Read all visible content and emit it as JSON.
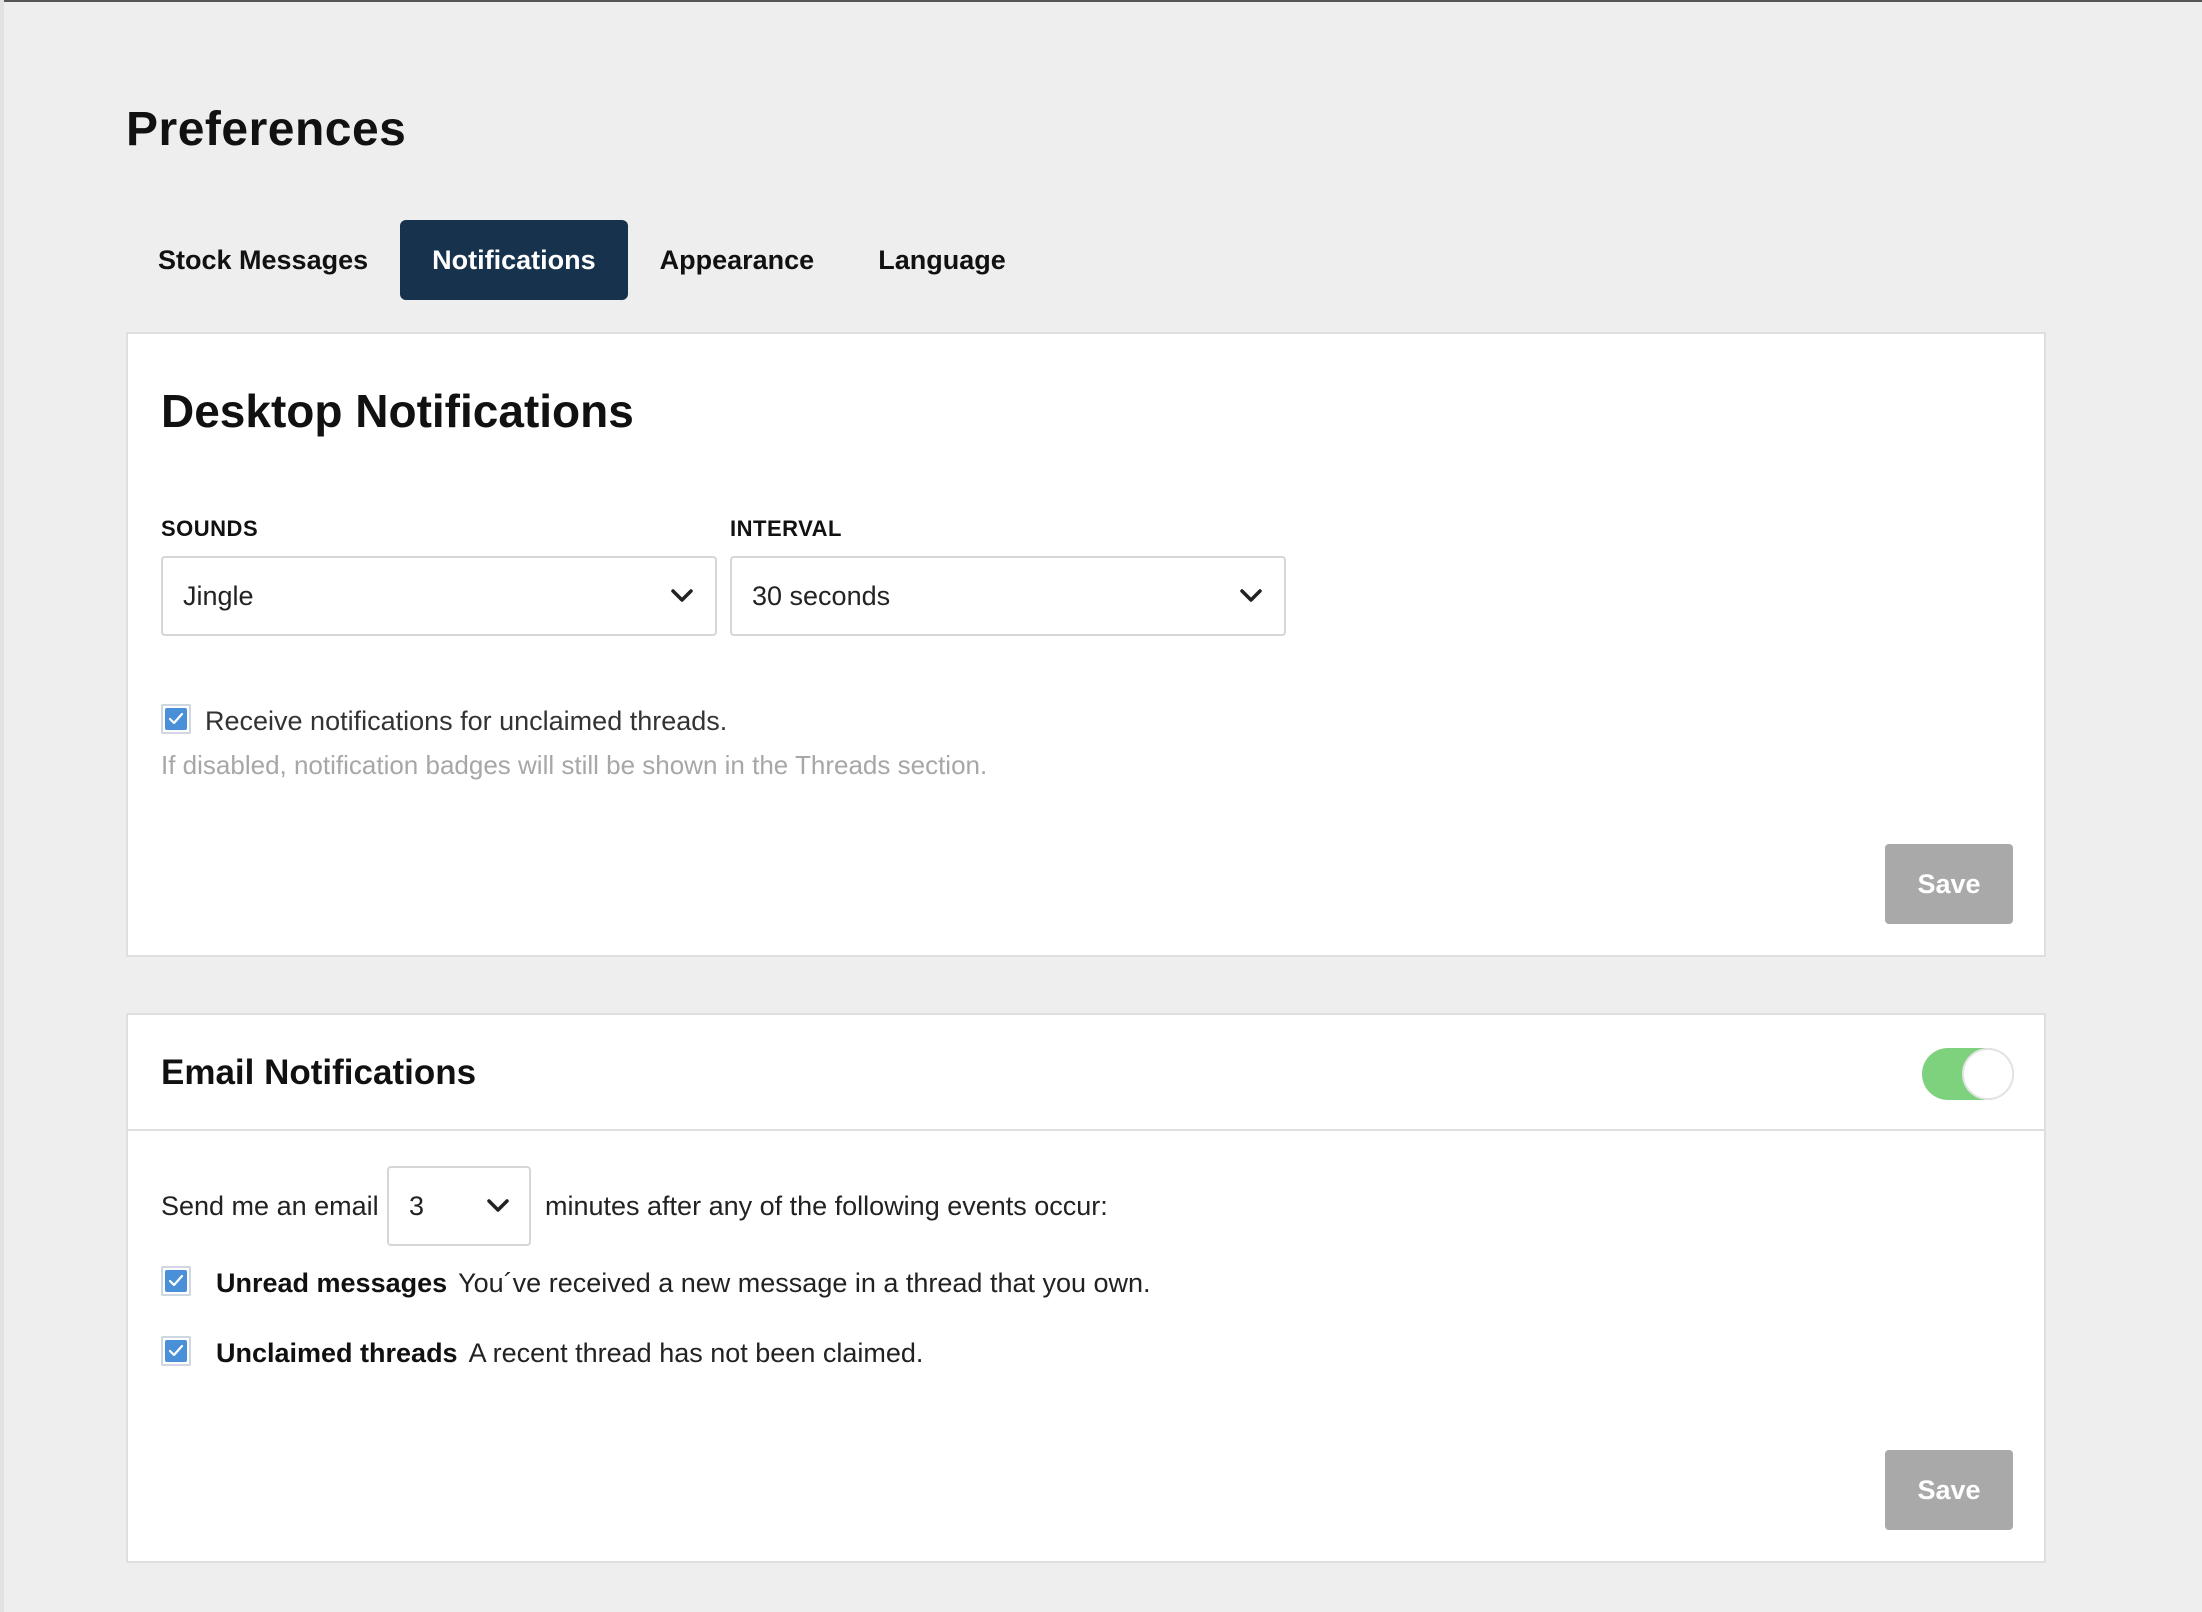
{
  "page_title": "Preferences",
  "tabs": [
    {
      "label": "Stock Messages",
      "active": false
    },
    {
      "label": "Notifications",
      "active": true
    },
    {
      "label": "Appearance",
      "active": false
    },
    {
      "label": "Language",
      "active": false
    }
  ],
  "desktop": {
    "title": "Desktop Notifications",
    "sounds_label": "SOUNDS",
    "sounds_value": "Jingle",
    "interval_label": "INTERVAL",
    "interval_value": "30 seconds",
    "unclaimed_checkbox_label": "Receive notifications for unclaimed threads.",
    "unclaimed_checked": true,
    "help_text": "If disabled, notification badges will still be shown in the Threads section.",
    "save_label": "Save"
  },
  "email": {
    "title": "Email Notifications",
    "enabled": true,
    "sentence_prefix": "Send me an email",
    "minutes_value": "3",
    "sentence_suffix": "minutes after any of the following events occur:",
    "events": [
      {
        "title": "Unread messages",
        "description": "You´ve received a new message in a thread that you own.",
        "checked": true
      },
      {
        "title": "Unclaimed threads",
        "description": "A recent thread has not been claimed.",
        "checked": true
      }
    ],
    "save_label": "Save"
  },
  "colors": {
    "active_tab": "#17324d",
    "checkbox_blue": "#4a90d9",
    "toggle_on": "#7ed27e",
    "disabled_button": "#a9a9a9"
  }
}
